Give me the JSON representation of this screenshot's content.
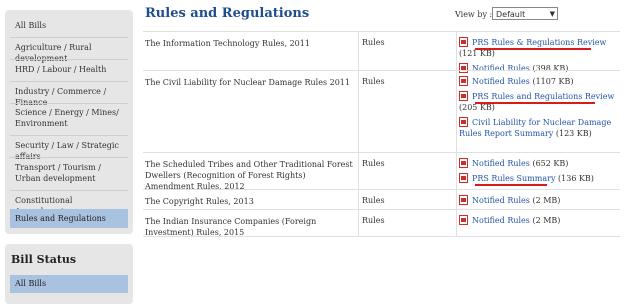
{
  "sidebar": {
    "items": [
      {
        "label": "All Bills"
      },
      {
        "label": "Agriculture / Rural development"
      },
      {
        "label": "HRD / Labour / Health"
      },
      {
        "label": "Industry / Commerce / Finance"
      },
      {
        "label": "Science / Energy / Mines/ Environment"
      },
      {
        "label": "Security / Law / Strategic affairs"
      },
      {
        "label": "Transport / Tourism / Urban development"
      },
      {
        "label": "Constitutional Amendments"
      },
      {
        "label": "Rules and Regulations"
      }
    ],
    "active_index": 8
  },
  "bill_status": {
    "title": "Bill Status",
    "first_item": "All Bills"
  },
  "main": {
    "title": "Rules and Regulations",
    "viewby_label": "View by :",
    "viewby_value": "Default"
  },
  "rows": [
    {
      "name": "The Information Technology Rules, 2011",
      "type": "Rules",
      "links": [
        {
          "text": "PRS Rules & Regulations Review",
          "size": "(121 KB)",
          "underlined": true
        },
        {
          "text": "Notified Rules",
          "size": "(398 KB)",
          "underlined": false
        }
      ]
    },
    {
      "name": "The Civil Liability for Nuclear Damage Rules 2011",
      "type": "Rules",
      "links": [
        {
          "text": "Notified Rules",
          "size": "(1107 KB)",
          "underlined": false
        },
        {
          "text": "PRS Rules and Regulations Review",
          "size": "(205 KB)",
          "underlined": true
        },
        {
          "text": "Civil Liability for Nuclear Damage Rules Report Summary",
          "size": "(123 KB)",
          "underlined": false
        }
      ]
    },
    {
      "name": "The Scheduled Tribes and Other Traditional Forest Dwellers (Recognition of Forest Rights) Amendment Rules, 2012",
      "type": "Rules",
      "links": [
        {
          "text": "Notified Rules",
          "size": "(652 KB)",
          "underlined": false
        },
        {
          "text": "PRS Rules Summary",
          "size": "(136 KB)",
          "underlined": true
        }
      ]
    },
    {
      "name": "The Copyright Rules, 2013",
      "type": "Rules",
      "links": [
        {
          "text": "Notified Rules",
          "size": "(2 MB)",
          "underlined": false
        }
      ]
    },
    {
      "name": "The Indian Insurance Companies (Foreign Investment) Rules, 2015",
      "type": "Rules",
      "links": [
        {
          "text": "Notified Rules",
          "size": "(2 MB)",
          "underlined": false
        }
      ]
    }
  ],
  "colors": {
    "title": "#1f4e8c",
    "link": "#2256a5",
    "active_bg": "#a8c2df",
    "underline": "#d81b1b",
    "pdf_icon": "#c9302c"
  }
}
